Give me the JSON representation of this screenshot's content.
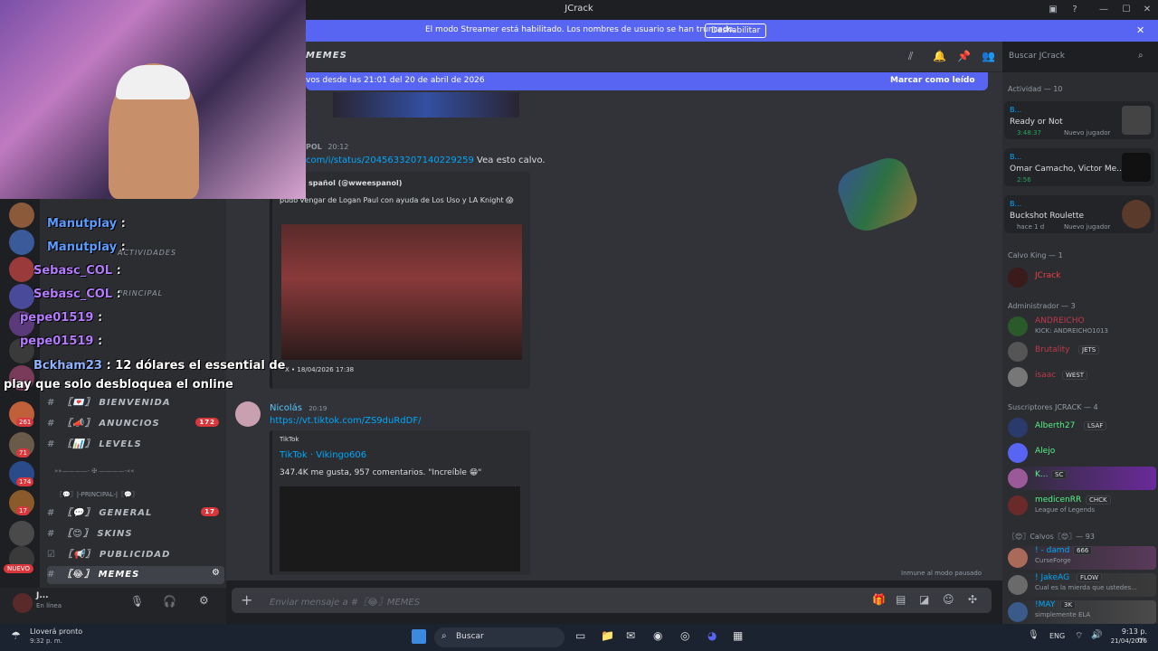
{
  "window": {
    "title": "JCrack"
  },
  "banner": {
    "text": "El modo Streamer está habilitado. Los nombres de usuario se han truncado.",
    "button": "Deshabilitar"
  },
  "channel_header": {
    "name": "MEMES"
  },
  "search": {
    "placeholder": "Buscar JCrack"
  },
  "new_messages": {
    "text": "vos desde las 21:01 del 20 de abril de 2026",
    "action": "Marcar como leído"
  },
  "servers": {
    "badges": [
      "261",
      "71",
      "174",
      "17"
    ],
    "nuevo": "NUEVO"
  },
  "channels": {
    "categories": [
      "ACTIVIDADES",
      "PRINCIPAL"
    ],
    "items": [
      {
        "name": "BIENVENIDA",
        "prefix": "〖💌〗"
      },
      {
        "name": "ANUNCIOS",
        "prefix": "〖📣〗",
        "badge": "172"
      },
      {
        "name": "LEVELS",
        "prefix": "〖📊〗"
      },
      {
        "name": "GENERAL",
        "prefix": "〖💬〗",
        "badge": "17"
      },
      {
        "name": "SKINS",
        "prefix": "〖😊〗"
      },
      {
        "name": "PUBLICIDAD",
        "prefix": "〖📢〗"
      },
      {
        "name": "MEMES",
        "prefix": "〖😂〗"
      }
    ],
    "principal_header": "〖💬〗|-PRINCIPAL-|〖💬〗",
    "divider": "»»————- ✠ ————-««"
  },
  "user": {
    "name": "J...",
    "status": "En línea"
  },
  "messages": [
    {
      "author": "POL",
      "time": "20:12",
      "link": "com/i/status/2045633207140229259",
      "text": "Vea esto calvo.",
      "embed": {
        "provider": "spañol (@wweespanol)",
        "desc": "pudo vengar de Logan Paul con ayuda de Los Uso y LA Knight 😱",
        "footer": "X • 18/04/2026 17:38"
      }
    },
    {
      "author": "Nicolás",
      "time": "20:19",
      "link": "https://vt.tiktok.com/ZS9duRdDF/",
      "embed": {
        "provider": "TikTok",
        "title": "TikTok · Vikingo606",
        "desc": "347.4K me gusta, 957 comentarios. \"Increíble 😁\""
      }
    }
  ],
  "composer": {
    "placeholder": "Enviar mensaje a #〖😂〗MEMES"
  },
  "immune": "Inmune al modo pausado",
  "stream_chat": [
    {
      "user": "Manutplay",
      "text": ":",
      "color": "#5b9cff"
    },
    {
      "user": "Manutplay",
      "text": ":",
      "color": "#5b9cff"
    },
    {
      "user": "Sebasc_COL",
      "text": ":",
      "color": "#b57bff"
    },
    {
      "user": "Sebasc_COL",
      "text": ":",
      "color": "#b57bff"
    },
    {
      "user": "pepe01519",
      "text": ":",
      "color": "#b57bff"
    },
    {
      "user": "pepe01519",
      "text": ":",
      "color": "#b57bff"
    },
    {
      "user": "Bckham23",
      "text": ": 12 dólares el essential de",
      "color": "#8fb3ff"
    },
    {
      "user": "",
      "text": "play que solo desbloquea el online",
      "color": "#ffffff"
    }
  ],
  "members": {
    "activity_header": "Actividad — 10",
    "activities": [
      {
        "name": "B...",
        "game": "Ready or Not",
        "time": "3:48:37",
        "note": "Nuevo jugador"
      },
      {
        "name": "B...",
        "game": "Omar Camacho, Victor Me...",
        "time": "2:56",
        "note": ""
      },
      {
        "name": "B...",
        "game": "Buckshot Roulette",
        "time": "hace 1 d",
        "note": "Nuevo jugador"
      }
    ],
    "groups": [
      {
        "header": "Calvo King — 1",
        "members": [
          {
            "name": "JCrack",
            "color": "#f23f43",
            "sub": "",
            "tag": ""
          }
        ]
      },
      {
        "header": "Administrador — 3",
        "members": [
          {
            "name": "ANDREICHO",
            "color": "#c0394b",
            "sub": "KICK: ANDREICHO1013",
            "tag": ""
          },
          {
            "name": "Brutality",
            "color": "#c0394b",
            "sub": "",
            "tag": "JETS"
          },
          {
            "name": "isaac",
            "color": "#c0394b",
            "sub": "",
            "tag": "WEST"
          }
        ]
      },
      {
        "header": "Suscriptores JCRACK — 4",
        "members": [
          {
            "name": "Alberth27",
            "color": "#57f287",
            "sub": "",
            "tag": "LSAF"
          },
          {
            "name": "Alejo",
            "color": "#57f287",
            "sub": "",
            "tag": ""
          },
          {
            "name": "K...",
            "color": "#57f287",
            "sub": "",
            "tag": "SC"
          },
          {
            "name": "medicenRR",
            "color": "#57f287",
            "sub": "League of Legends",
            "tag": "CHCK"
          }
        ]
      },
      {
        "header": "〖😊〗Calvos〖😊〗— 93",
        "members": [
          {
            "name": "! - damd",
            "color": "#00a8fc",
            "sub": "CurseForge",
            "tag": "666"
          },
          {
            "name": "! JakeAG",
            "color": "#00a8fc",
            "sub": "Cual es la mierda que ustedes...",
            "tag": "FLOW"
          },
          {
            "name": "!MAY",
            "color": "#00a8fc",
            "sub": "simplemente ELA",
            "tag": "3K"
          }
        ]
      }
    ]
  },
  "taskbar": {
    "weather": "Lloverá pronto",
    "weather_time": "9:32 p. m.",
    "search": "Buscar",
    "lang": "ENG",
    "time": "9:13 p. m.",
    "date": "21/04/2026"
  },
  "colors": {
    "accent": "#5865f2",
    "link": "#00a8fc",
    "green": "#23a55a"
  }
}
